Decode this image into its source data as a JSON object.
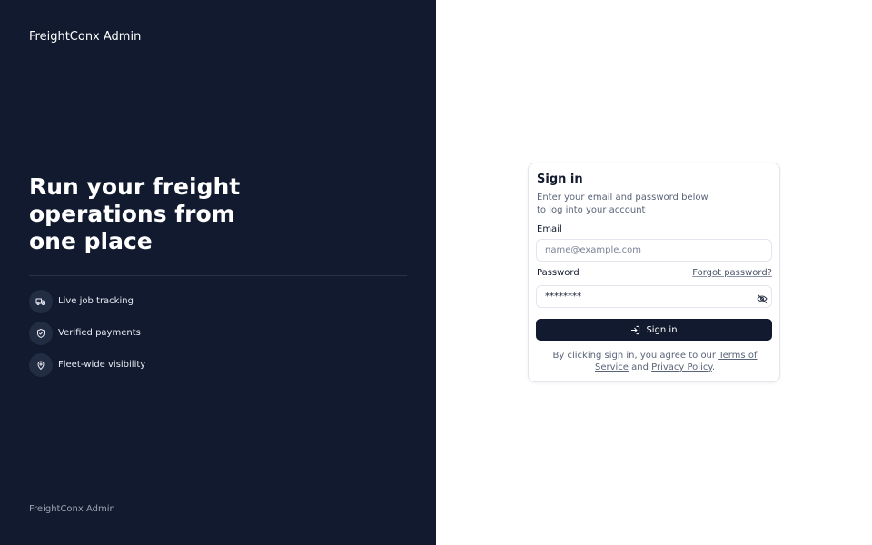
{
  "brand": {
    "name": "FreightConx Admin"
  },
  "hero": {
    "headline": "Run your freight operations from one place",
    "features": [
      {
        "icon": "truck-icon",
        "label": "Live job tracking"
      },
      {
        "icon": "shield-check-icon",
        "label": "Verified payments"
      },
      {
        "icon": "map-pin-icon",
        "label": "Fleet-wide visibility"
      }
    ]
  },
  "footer": {
    "brand": "FreightConx Admin"
  },
  "signin": {
    "title": "Sign in",
    "subtitle": "Enter your email and password below to log into your account",
    "email_label": "Email",
    "email_placeholder": "name@example.com",
    "email_value": "",
    "password_label": "Password",
    "password_value": "********",
    "forgot_label": "Forgot password?",
    "submit_label": "Sign in",
    "terms_prefix": "By clicking sign in, you agree to our ",
    "terms_link": "Terms of Service",
    "terms_and": " and ",
    "privacy_link": "Privacy Policy",
    "terms_suffix": "."
  },
  "colors": {
    "panel_bg": "#111a2e",
    "accent": "#111a2e",
    "muted_text": "#5a6478"
  }
}
